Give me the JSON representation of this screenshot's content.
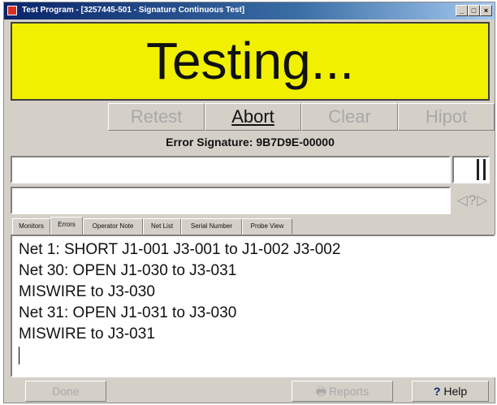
{
  "window": {
    "title": "Test Program - [3257445-501 - Signature Continuous Test]",
    "controls": {
      "minimize": "_",
      "maximize": "□",
      "close": "×"
    }
  },
  "status": {
    "text": "Testing...",
    "background_color": "#f0f000"
  },
  "actions": [
    {
      "label": "Retest",
      "enabled": false
    },
    {
      "label": "Abort",
      "enabled": true
    },
    {
      "label": "Clear",
      "enabled": false
    },
    {
      "label": "Hipot",
      "enabled": false
    }
  ],
  "error_signature": "Error Signature: 9B7D9E-00000",
  "inputs": {
    "field1": "",
    "field2": ""
  },
  "nav": {
    "prev_icon": "◁",
    "help_icon": "?",
    "next_icon": "▷"
  },
  "tabs": [
    {
      "label": "Monitors",
      "selected": false
    },
    {
      "label": "Errors",
      "selected": true
    },
    {
      "label": "Operator Note",
      "selected": false
    },
    {
      "label": "Net List",
      "selected": false
    },
    {
      "label": "Serial Number",
      "selected": false
    },
    {
      "label": "Probe View",
      "selected": false
    }
  ],
  "errors": [
    "Net 1: SHORT J1-001 J3-001 to J1-002 J3-002",
    "Net 30: OPEN J1-030 to J3-031",
    "MISWIRE to J3-030",
    "Net 31: OPEN J1-031 to J3-030",
    "MISWIRE to J3-031"
  ],
  "bottom": {
    "done_label": "Done",
    "reports_label": "Reports",
    "reports_icon": "print-icon",
    "help_label": "Help",
    "help_icon": "question-icon"
  }
}
